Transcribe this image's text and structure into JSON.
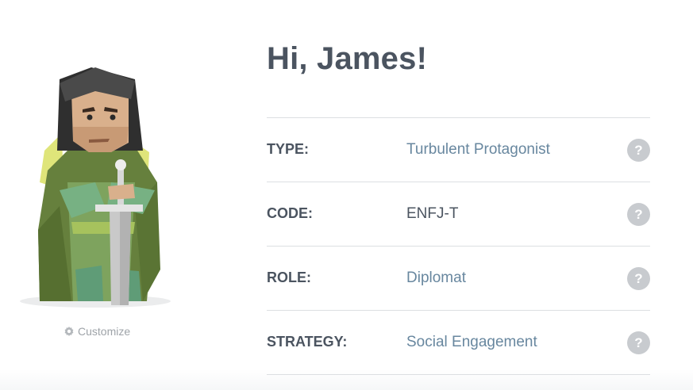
{
  "avatar": {
    "icon": "protagonist-avatar",
    "customize_icon": "gear-icon",
    "customize_label": "Customize"
  },
  "profile": {
    "greeting": "Hi, James!",
    "rows": [
      {
        "label": "TYPE:",
        "value": "Turbulent Protagonist",
        "link": true,
        "help_icon": "?"
      },
      {
        "label": "CODE:",
        "value": "ENFJ-T",
        "link": false,
        "help_icon": "?"
      },
      {
        "label": "ROLE:",
        "value": "Diplomat",
        "link": true,
        "help_icon": "?"
      },
      {
        "label": "STRATEGY:",
        "value": "Social Engagement",
        "link": true,
        "help_icon": "?"
      }
    ]
  },
  "colors": {
    "heading": "#4b5460",
    "link": "#68879f",
    "help_icon_bg": "#c8cbcf",
    "divider": "#dcdfe2"
  }
}
